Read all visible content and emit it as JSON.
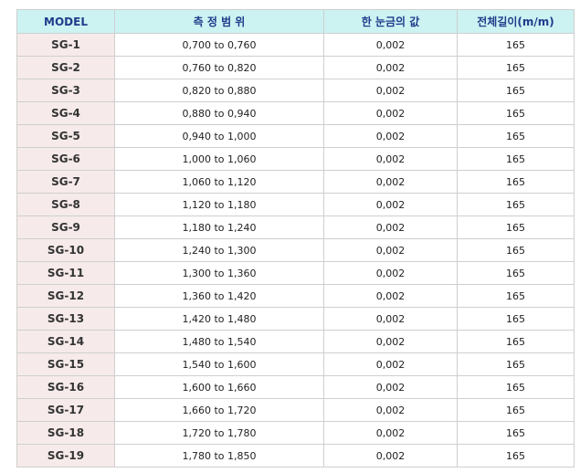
{
  "table": {
    "headers": [
      "MODEL",
      "측 정 범 위",
      "한 눈금의 값",
      "전체길이(m/m)"
    ],
    "rows": [
      [
        "SG-1",
        "0,700 to 0,760",
        "0,002",
        "165"
      ],
      [
        "SG-2",
        "0,760 to 0,820",
        "0,002",
        "165"
      ],
      [
        "SG-3",
        "0,820 to 0,880",
        "0,002",
        "165"
      ],
      [
        "SG-4",
        "0,880 to 0,940",
        "0,002",
        "165"
      ],
      [
        "SG-5",
        "0,940 to 1,000",
        "0,002",
        "165"
      ],
      [
        "SG-6",
        "1,000 to 1,060",
        "0,002",
        "165"
      ],
      [
        "SG-7",
        "1,060 to 1,120",
        "0,002",
        "165"
      ],
      [
        "SG-8",
        "1,120 to 1,180",
        "0,002",
        "165"
      ],
      [
        "SG-9",
        "1,180 to 1,240",
        "0,002",
        "165"
      ],
      [
        "SG-10",
        "1,240 to 1,300",
        "0,002",
        "165"
      ],
      [
        "SG-11",
        "1,300 to 1,360",
        "0,002",
        "165"
      ],
      [
        "SG-12",
        "1,360 to 1,420",
        "0,002",
        "165"
      ],
      [
        "SG-13",
        "1,420 to 1,480",
        "0,002",
        "165"
      ],
      [
        "SG-14",
        "1,480 to 1,540",
        "0,002",
        "165"
      ],
      [
        "SG-15",
        "1,540 to 1,600",
        "0,002",
        "165"
      ],
      [
        "SG-16",
        "1,600 to 1,660",
        "0,002",
        "165"
      ],
      [
        "SG-17",
        "1,660 to 1,720",
        "0,002",
        "165"
      ],
      [
        "SG-18",
        "1,720 to 1,780",
        "0,002",
        "165"
      ],
      [
        "SG-19",
        "1,780 to 1,850",
        "0,002",
        "165"
      ]
    ]
  },
  "colors": {
    "header_bg": "#ccf2f2",
    "header_text": "#1f3d8c",
    "model_bg": "#f6eaea",
    "border": "#cfcfcf"
  }
}
